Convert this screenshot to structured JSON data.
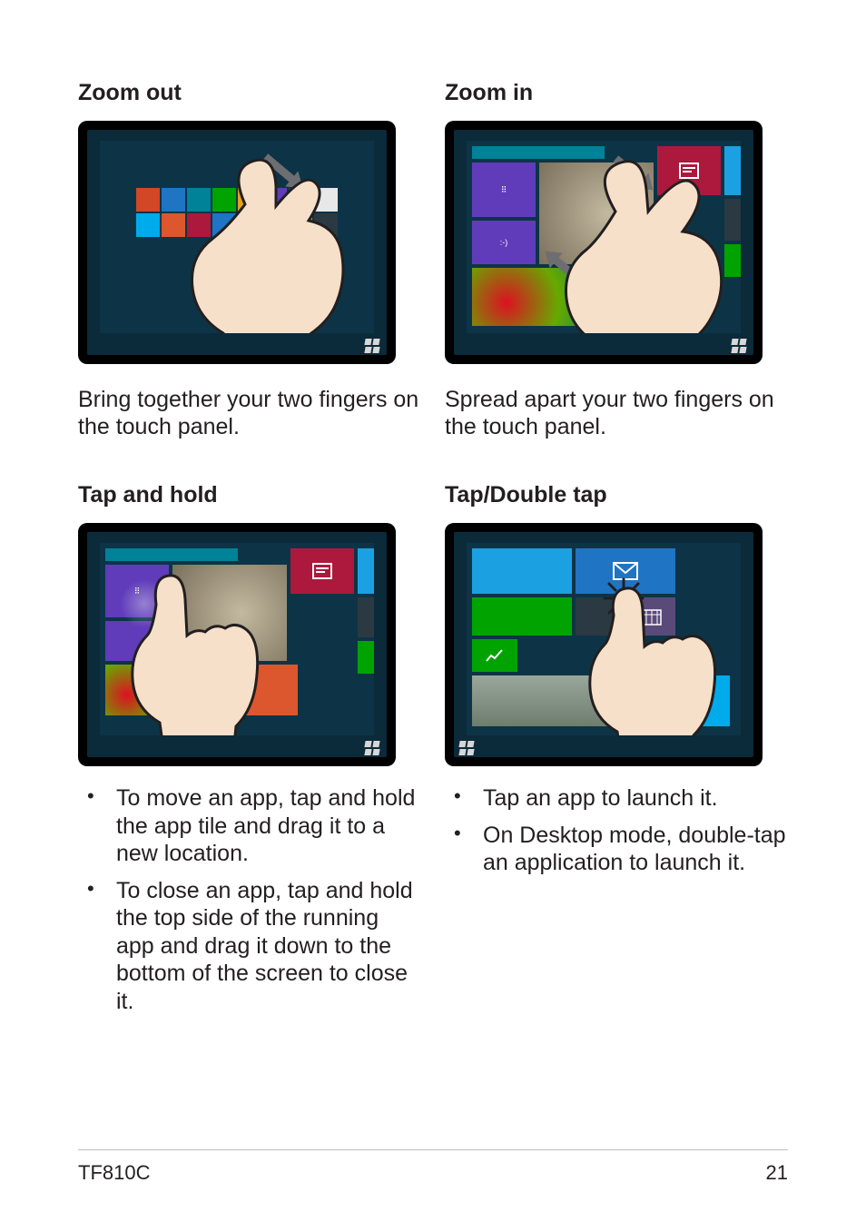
{
  "sections": {
    "zoom_out": {
      "title": "Zoom out",
      "desc": "Bring together your two fingers on the touch panel."
    },
    "zoom_in": {
      "title": "Zoom in",
      "desc": "Spread apart your two fingers on the touch panel."
    },
    "tap_hold": {
      "title": "Tap and hold",
      "bullets": [
        "To move an app, tap and hold the app tile and drag it to a new location.",
        "To close an app, tap and hold the top side of the running app and drag it down to the bottom of the screen to close it."
      ]
    },
    "tap_double": {
      "title": "Tap/Double tap",
      "bullets": [
        "Tap an app to launch it.",
        "On Desktop mode, double-tap an application to launch it."
      ]
    }
  },
  "footer": {
    "model": "TF810C",
    "page": "21"
  }
}
